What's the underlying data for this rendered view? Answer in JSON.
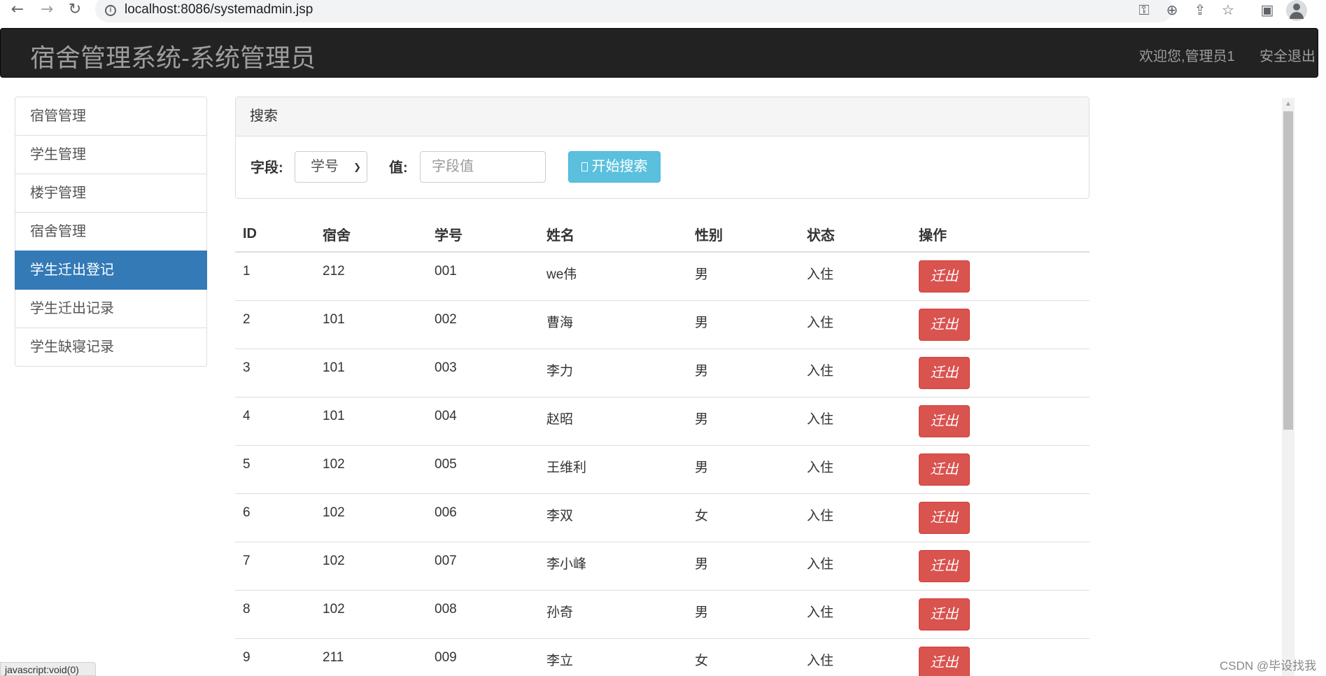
{
  "browser": {
    "url": "localhost:8086/systemadmin.jsp",
    "back_glyph": "←",
    "forward_glyph": "→",
    "reload_glyph": "↻",
    "info_glyph": "i",
    "key_glyph": "⚿",
    "zoom_glyph": "⊕",
    "share_glyph": "⇪",
    "star_glyph": "☆",
    "panel_glyph": "▣"
  },
  "header": {
    "title": "宿舍管理系统-系统管理员",
    "welcome": "欢迎您,管理员1",
    "logout": "安全退出"
  },
  "sidebar": {
    "items": [
      {
        "label": "宿管管理"
      },
      {
        "label": "学生管理"
      },
      {
        "label": "楼宇管理"
      },
      {
        "label": "宿舍管理"
      },
      {
        "label": "学生迁出登记"
      },
      {
        "label": "学生迁出记录"
      },
      {
        "label": "学生缺寝记录"
      }
    ],
    "active_index": 4
  },
  "search": {
    "heading": "搜索",
    "field_label": "字段:",
    "field_selected": "学号",
    "value_label": "值:",
    "value_placeholder": "字段值",
    "button_label": "开始搜索"
  },
  "table": {
    "headers": {
      "id": "ID",
      "dorm": "宿舍",
      "student_no": "学号",
      "name": "姓名",
      "gender": "性别",
      "status": "状态",
      "action": "操作"
    },
    "action_label": "迁出",
    "rows": [
      {
        "id": "1",
        "dorm": "212",
        "student_no": "001",
        "name": "we伟",
        "gender": "男",
        "status": "入住"
      },
      {
        "id": "2",
        "dorm": "101",
        "student_no": "002",
        "name": "曹海",
        "gender": "男",
        "status": "入住"
      },
      {
        "id": "3",
        "dorm": "101",
        "student_no": "003",
        "name": "李力",
        "gender": "男",
        "status": "入住"
      },
      {
        "id": "4",
        "dorm": "101",
        "student_no": "004",
        "name": "赵昭",
        "gender": "男",
        "status": "入住"
      },
      {
        "id": "5",
        "dorm": "102",
        "student_no": "005",
        "name": "王维利",
        "gender": "男",
        "status": "入住"
      },
      {
        "id": "6",
        "dorm": "102",
        "student_no": "006",
        "name": "李双",
        "gender": "女",
        "status": "入住"
      },
      {
        "id": "7",
        "dorm": "102",
        "student_no": "007",
        "name": "李小峰",
        "gender": "男",
        "status": "入住"
      },
      {
        "id": "8",
        "dorm": "102",
        "student_no": "008",
        "name": "孙奇",
        "gender": "男",
        "status": "入住"
      },
      {
        "id": "9",
        "dorm": "211",
        "student_no": "009",
        "name": "李立",
        "gender": "女",
        "status": "入住"
      }
    ]
  },
  "status_bar": "javascript:void(0)",
  "watermark": "CSDN @毕设找我",
  "colors": {
    "header_bg": "#222222",
    "active_blue": "#337ab7",
    "info_button": "#5bc0de",
    "danger_button": "#d9534f"
  }
}
